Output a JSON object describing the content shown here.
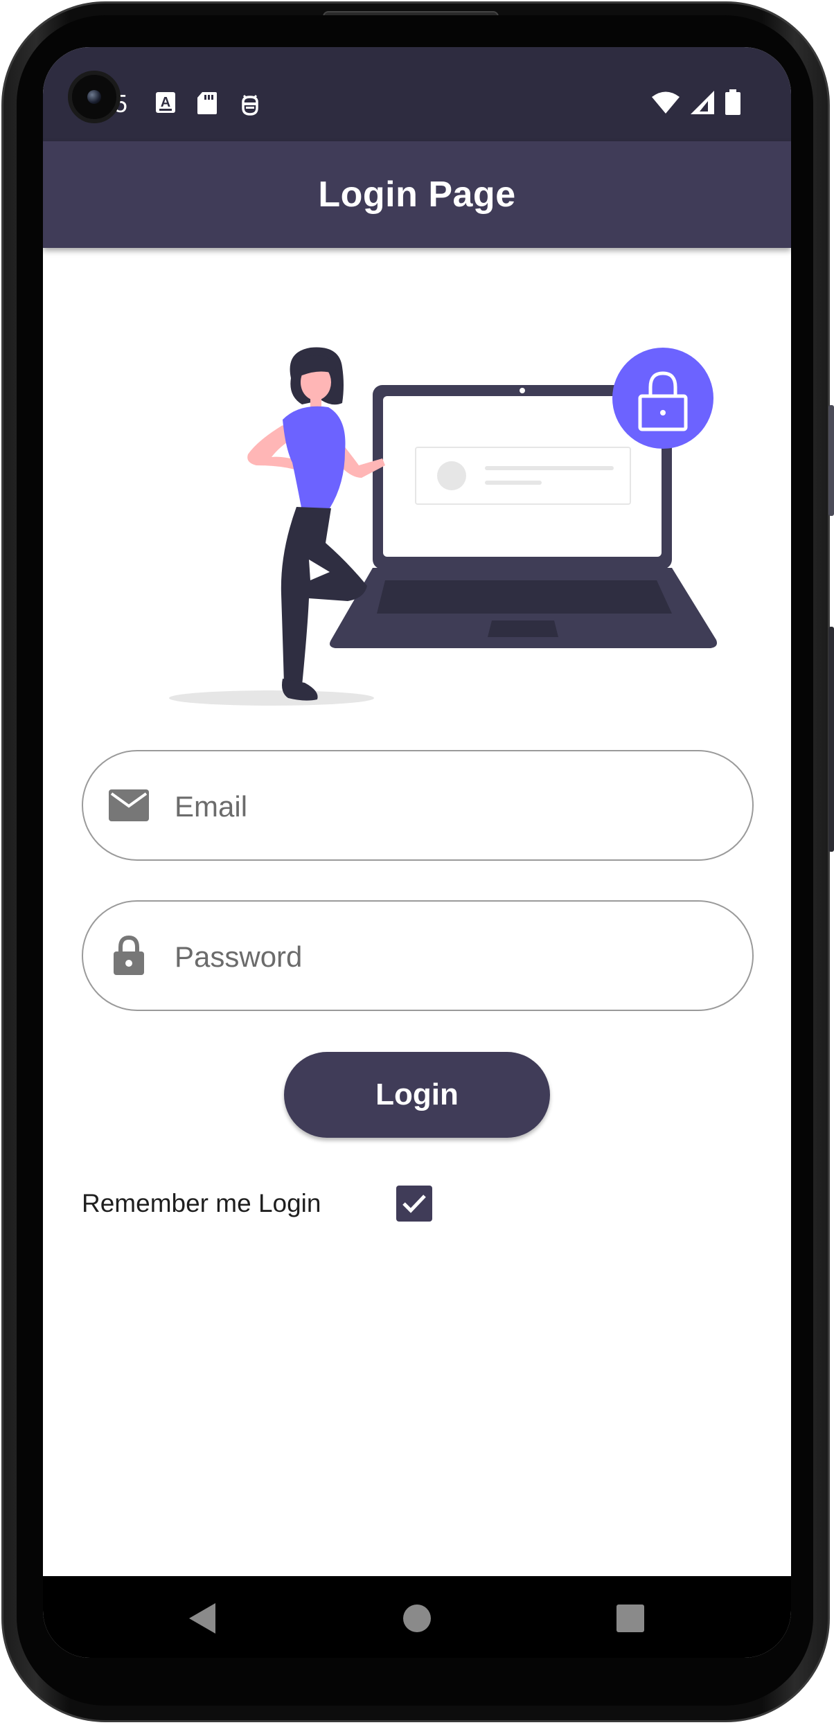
{
  "status_bar": {
    "time": "5",
    "left_icons": [
      "font-a-icon",
      "sd-card-icon",
      "debug-bug-icon"
    ],
    "right_icons": [
      "wifi-icon",
      "cell-signal-icon",
      "battery-icon"
    ]
  },
  "app_bar": {
    "title": "Login Page"
  },
  "illustration": {
    "name": "login-illustration",
    "colors": {
      "accent": "#6c63ff",
      "dark": "#3f3d56",
      "skin": "#ffb6b6"
    }
  },
  "form": {
    "email": {
      "icon": "mail-icon",
      "placeholder": "Email",
      "value": ""
    },
    "password": {
      "icon": "lock-icon",
      "placeholder": "Password",
      "value": ""
    },
    "login_button_label": "Login",
    "remember_me": {
      "label": "Remember me Login",
      "checked": true
    }
  },
  "nav_bar": {
    "buttons": [
      "back-icon",
      "home-icon",
      "recents-icon"
    ]
  },
  "colors": {
    "primary": "#403c58",
    "status_bar": "#2e2c40",
    "field_border": "#9a9a9a",
    "placeholder": "#6b6b6b"
  }
}
